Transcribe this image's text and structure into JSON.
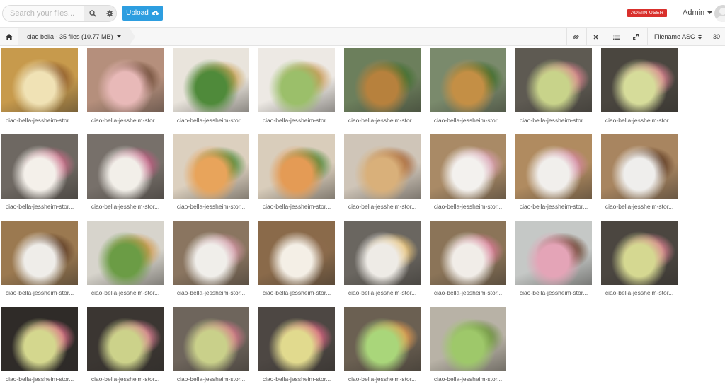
{
  "search": {
    "placeholder": "Search your files..."
  },
  "upload": {
    "label": "Upload"
  },
  "user": {
    "badge": "ADMIN USER",
    "name": "Admin"
  },
  "breadcrumb": {
    "label": "ciao bella - 35 files (10.77 MB)"
  },
  "toolbar": {
    "sort_label": "Filename ASC",
    "per_page": "30"
  },
  "colors": {
    "accent": "#2d9ee0",
    "admin_badge": "#d9302c"
  },
  "icons": [
    "search-icon",
    "gear-icon",
    "cloud-upload-icon",
    "caret-down-icon",
    "home-icon",
    "link-icon",
    "close-icon",
    "list-icon",
    "expand-icon",
    "sort-icon",
    "user-avatar-icon"
  ],
  "files": [
    {
      "name": "ciao-bella-jessheim-stor..."
    },
    {
      "name": "ciao-bella-jessheim-stor..."
    },
    {
      "name": "ciao-bella-jessheim-stor..."
    },
    {
      "name": "ciao-bella-jessheim-stor..."
    },
    {
      "name": "ciao-bella-jessheim-stor..."
    },
    {
      "name": "ciao-bella-jessheim-stor..."
    },
    {
      "name": "ciao-bella-jessheim-stor..."
    },
    {
      "name": "ciao-bella-jessheim-stor..."
    },
    {
      "name": "ciao-bella-jessheim-stor..."
    },
    {
      "name": "ciao-bella-jessheim-stor..."
    },
    {
      "name": "ciao-bella-jessheim-stor..."
    },
    {
      "name": "ciao-bella-jessheim-stor..."
    },
    {
      "name": "ciao-bella-jessheim-stor..."
    },
    {
      "name": "ciao-bella-jessheim-stor..."
    },
    {
      "name": "ciao-bella-jessheim-stor..."
    },
    {
      "name": "ciao-bella-jessheim-stor..."
    },
    {
      "name": "ciao-bella-jessheim-stor..."
    },
    {
      "name": "ciao-bella-jessheim-stor..."
    },
    {
      "name": "ciao-bella-jessheim-stor..."
    },
    {
      "name": "ciao-bella-jessheim-stor..."
    },
    {
      "name": "ciao-bella-jessheim-stor..."
    },
    {
      "name": "ciao-bella-jessheim-stor..."
    },
    {
      "name": "ciao-bella-jessheim-stor..."
    },
    {
      "name": "ciao-bella-jessheim-stor..."
    },
    {
      "name": "ciao-bella-jessheim-stor..."
    },
    {
      "name": "ciao-bella-jessheim-stor..."
    },
    {
      "name": "ciao-bella-jessheim-stor..."
    },
    {
      "name": "ciao-bella-jessheim-stor..."
    },
    {
      "name": "ciao-bella-jessheim-stor..."
    },
    {
      "name": "ciao-bella-jessheim-stor..."
    }
  ]
}
